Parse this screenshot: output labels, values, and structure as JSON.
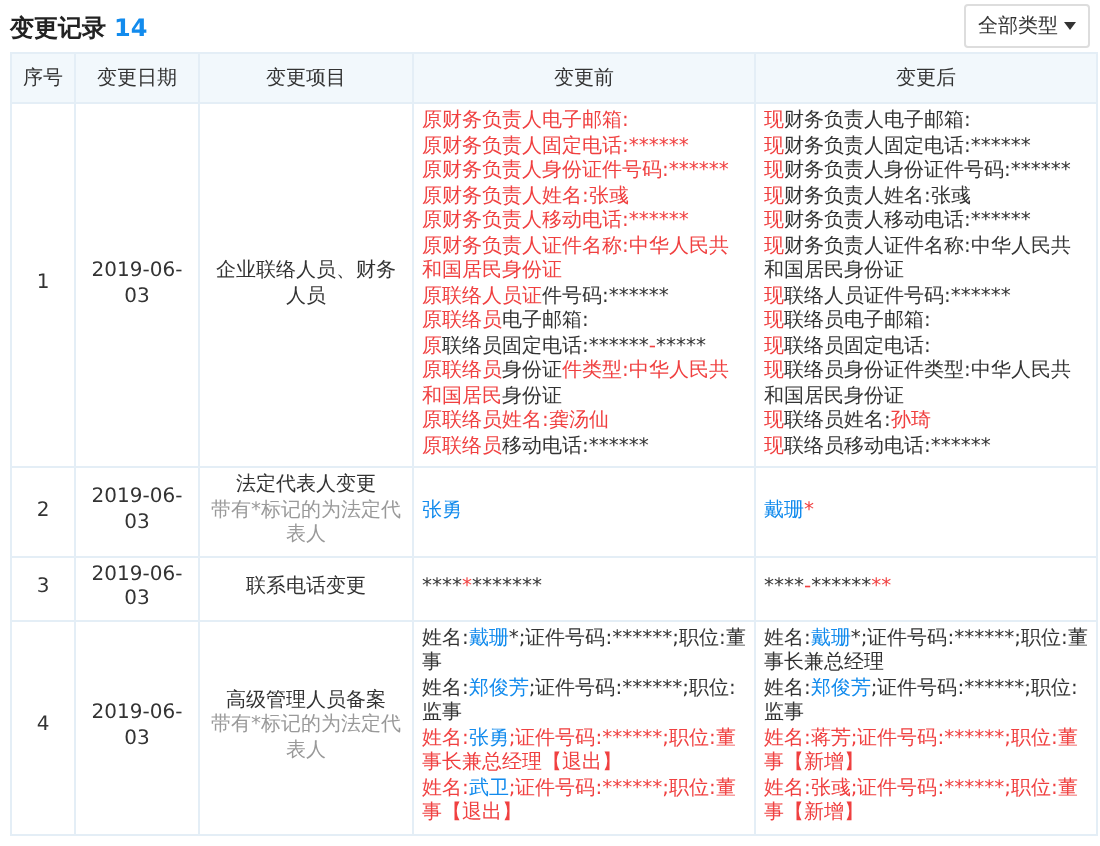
{
  "title": "变更记录",
  "count": "14",
  "filter": {
    "label": "全部类型"
  },
  "columns": [
    "序号",
    "变更日期",
    "变更项目",
    "变更前",
    "变更后"
  ],
  "rows": [
    {
      "index": "1",
      "date": "2019-06-03",
      "item": "企业联络人员、财务人员",
      "before": [
        [
          {
            "kind": "red",
            "text": "原财务负责人电子邮箱:"
          }
        ],
        [
          {
            "kind": "red",
            "text": "原财务负责人固定电话:******"
          }
        ],
        [
          {
            "kind": "red",
            "text": "原财务负责人身份证件号码:******"
          }
        ],
        [
          {
            "kind": "red",
            "text": "原财务负责人姓名:张彧"
          }
        ],
        [
          {
            "kind": "red",
            "text": "原财务负责人移动电话:******"
          }
        ],
        [
          {
            "kind": "red",
            "text": "原财务负责人证件名称:中华人民共和国居民身份证"
          }
        ],
        [
          {
            "kind": "red",
            "text": "原联络人员证"
          },
          {
            "kind": "plain",
            "text": "件号码:******"
          }
        ],
        [
          {
            "kind": "red",
            "text": "原联络员"
          },
          {
            "kind": "plain",
            "text": "电子邮箱:"
          }
        ],
        [
          {
            "kind": "red",
            "text": "原"
          },
          {
            "kind": "plain",
            "text": "联络员固定电话:******"
          },
          {
            "kind": "red",
            "text": "-"
          },
          {
            "kind": "plain",
            "text": "*****"
          }
        ],
        [
          {
            "kind": "red",
            "text": "原联络员"
          },
          {
            "kind": "plain",
            "text": "身份证"
          },
          {
            "kind": "red",
            "text": "件类型:中华人民共和国居民"
          },
          {
            "kind": "plain",
            "text": "身份证"
          }
        ],
        [
          {
            "kind": "red",
            "text": "原联络员姓名:龚汤仙"
          }
        ],
        [
          {
            "kind": "red",
            "text": "原联络员"
          },
          {
            "kind": "plain",
            "text": "移动电话:******"
          }
        ]
      ],
      "after": [
        [
          {
            "kind": "red",
            "text": "现"
          },
          {
            "kind": "plain",
            "text": "财务负责人电子邮箱:"
          }
        ],
        [
          {
            "kind": "red",
            "text": "现"
          },
          {
            "kind": "plain",
            "text": "财务负责人固定电话:******"
          }
        ],
        [
          {
            "kind": "red",
            "text": "现"
          },
          {
            "kind": "plain",
            "text": "财务负责人身份证件号码:******"
          }
        ],
        [
          {
            "kind": "red",
            "text": "现"
          },
          {
            "kind": "plain",
            "text": "财务负责人姓名:张彧"
          }
        ],
        [
          {
            "kind": "red",
            "text": "现"
          },
          {
            "kind": "plain",
            "text": "财务负责人移动电话:******"
          }
        ],
        [
          {
            "kind": "red",
            "text": "现"
          },
          {
            "kind": "plain",
            "text": "财务负责人证件名称:中华人民共和国居民身份证"
          }
        ],
        [
          {
            "kind": "red",
            "text": "现"
          },
          {
            "kind": "plain",
            "text": "联络人员证件号码:******"
          }
        ],
        [
          {
            "kind": "red",
            "text": "现"
          },
          {
            "kind": "plain",
            "text": "联络员电子邮箱:"
          }
        ],
        [
          {
            "kind": "red",
            "text": "现"
          },
          {
            "kind": "plain",
            "text": "联络员固定电话:"
          }
        ],
        [
          {
            "kind": "red",
            "text": "现"
          },
          {
            "kind": "plain",
            "text": "联络员身份证件类型:中华人民共和国居民身份证"
          }
        ],
        [
          {
            "kind": "red",
            "text": "现"
          },
          {
            "kind": "plain",
            "text": "联络员姓名:"
          },
          {
            "kind": "red",
            "text": "孙琦"
          }
        ],
        [
          {
            "kind": "red",
            "text": "现"
          },
          {
            "kind": "plain",
            "text": "联络员移动电话:******"
          }
        ]
      ]
    },
    {
      "index": "2",
      "date": "2019-06-03",
      "item": "法定代表人变更",
      "note": "带有*标记的为法定代表人",
      "before": [
        [
          {
            "kind": "link",
            "text": "张勇"
          }
        ]
      ],
      "after": [
        [
          {
            "kind": "link",
            "text": "戴珊"
          },
          {
            "kind": "red",
            "text": "*"
          }
        ]
      ]
    },
    {
      "index": "3",
      "date": "2019-06-03",
      "item": "联系电话变更",
      "before": [
        [
          {
            "kind": "plain",
            "text": "****"
          },
          {
            "kind": "red",
            "text": "*"
          },
          {
            "kind": "plain",
            "text": "*******"
          }
        ]
      ],
      "after": [
        [
          {
            "kind": "plain",
            "text": "****"
          },
          {
            "kind": "red",
            "text": "-"
          },
          {
            "kind": "plain",
            "text": "******"
          },
          {
            "kind": "red",
            "text": "**"
          }
        ]
      ]
    },
    {
      "index": "4",
      "date": "2019-06-03",
      "item": "高级管理人员备案",
      "note": "带有*标记的为法定代表人",
      "before": [
        [
          {
            "kind": "plain",
            "text": "姓名:"
          },
          {
            "kind": "link",
            "text": "戴珊"
          },
          {
            "kind": "plain",
            "text": "*;证件号码:******;职位:董事"
          }
        ],
        [
          {
            "kind": "plain",
            "text": "姓名:"
          },
          {
            "kind": "link",
            "text": "郑俊芳"
          },
          {
            "kind": "plain",
            "text": ";证件号码:******;职位:监事"
          }
        ],
        [
          {
            "kind": "red",
            "text": "姓名:"
          },
          {
            "kind": "link",
            "text": "张勇"
          },
          {
            "kind": "red",
            "text": ";证件号码:******;职位:董事长兼总经理【退出】"
          }
        ],
        [
          {
            "kind": "red",
            "text": "姓名:"
          },
          {
            "kind": "link",
            "text": "武卫"
          },
          {
            "kind": "red",
            "text": ";证件号码:******;职位:董事【退出】"
          }
        ]
      ],
      "after": [
        [
          {
            "kind": "plain",
            "text": "姓名:"
          },
          {
            "kind": "link",
            "text": "戴珊"
          },
          {
            "kind": "plain",
            "text": "*;证件号码:******;职位:董事长兼总经理"
          }
        ],
        [
          {
            "kind": "plain",
            "text": "姓名:"
          },
          {
            "kind": "link",
            "text": "郑俊芳"
          },
          {
            "kind": "plain",
            "text": ";证件号码:******;职位:监事"
          }
        ],
        [
          {
            "kind": "red",
            "text": "姓名:蒋芳;证件号码:******;职位:董事【新增】"
          }
        ],
        [
          {
            "kind": "red",
            "text": "姓名:张彧;证件号码:******;职位:董事【新增】"
          }
        ]
      ]
    }
  ]
}
